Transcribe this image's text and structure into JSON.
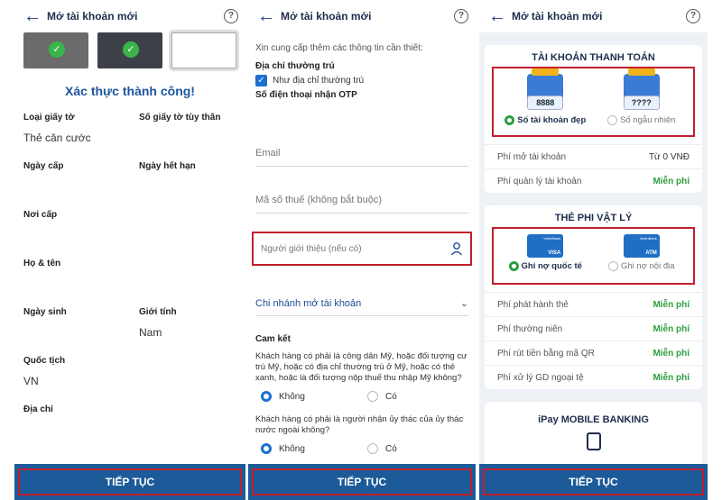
{
  "panel1": {
    "title": "Mở tài khoản mới",
    "success": "Xác thực thành công!",
    "fields": [
      {
        "label": "Loại giấy tờ",
        "value": "Thẻ căn cước"
      },
      {
        "label": "Số giấy tờ tùy thân",
        "value": ""
      },
      {
        "label": "Ngày cấp",
        "value": ""
      },
      {
        "label": "Ngày hết hạn",
        "value": ""
      },
      {
        "label": "Nơi cấp",
        "value": ""
      },
      {
        "label": "Họ & tên",
        "value": ""
      },
      {
        "label": "Ngày sinh",
        "value": ""
      },
      {
        "label": "Giới tính",
        "value": "Nam"
      },
      {
        "label": "Quốc tịch",
        "value": "VN"
      },
      {
        "label": "Địa chỉ",
        "value": ""
      }
    ],
    "button": "TIẾP TỤC"
  },
  "panel2": {
    "title": "Mở tài khoản mới",
    "intro": "Xin cung cấp thêm các thông tin cần thiết:",
    "address_label": "Địa chỉ thường trú",
    "same_address": "Như địa chỉ thường trú",
    "otp_label": "Số điện thoại nhận OTP",
    "email_placeholder": "Email",
    "tax_placeholder": "Mã số thuế (không bắt buộc)",
    "referrer_placeholder": "Người giới thiệu (nếu có)",
    "branch": "Chi nhánh mở tài khoản",
    "commit_label": "Cam kết",
    "q1": "Khách hàng có phải là công dân Mỹ, hoặc đối tượng cư trú Mỹ, hoặc có địa chỉ thường trú ở Mỹ, hoặc có thẻ xanh, hoặc là đối tượng nộp thuế thu nhập Mỹ không?",
    "q2": "Khách hàng có phải là người nhận ủy thác của ủy thác nước ngoài không?",
    "no": "Không",
    "yes": "Có",
    "button": "TIẾP TỤC"
  },
  "panel3": {
    "title": "Mở tài khoản mới",
    "account_title": "TÀI KHOẢN THANH TOÁN",
    "opt_nice": "Số tài khoản đẹp",
    "opt_random": "Số ngẫu nhiên",
    "code_nice": "8888",
    "code_random": "????",
    "fees1": [
      {
        "k": "Phí mở tài khoản",
        "v": "Từ 0 VNĐ"
      },
      {
        "k": "Phí quản lý tài khoản",
        "v": "Miễn phí"
      }
    ],
    "card_title": "THẺ PHI VẬT LÝ",
    "opt_intl": "Ghi nợ quốc tế",
    "opt_dom": "Ghi nợ nội địa",
    "card_visa": "VISA",
    "card_atm": "ATM",
    "card_bank": "VietinBank",
    "fees2": [
      {
        "k": "Phí phát hành thẻ",
        "v": "Miễn phí"
      },
      {
        "k": "Phí thường niên",
        "v": "Miễn phí"
      },
      {
        "k": "Phí rút tiền bằng mã QR",
        "v": "Miễn phí"
      },
      {
        "k": "Phí xử lý GD ngoại tệ",
        "v": "Miễn phí"
      }
    ],
    "ipay": "iPay MOBILE BANKING",
    "button": "TIẾP TỤC"
  },
  "icons": {
    "back": "←",
    "help": "?",
    "check": "✓",
    "chevron": "⌄"
  }
}
